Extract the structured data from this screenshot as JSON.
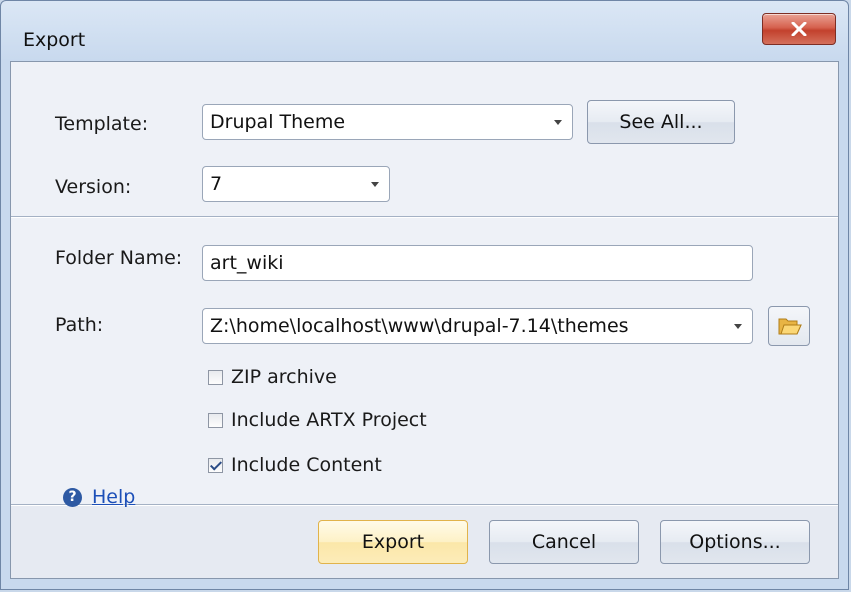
{
  "window": {
    "title": "Export"
  },
  "form": {
    "template_label": "Template:",
    "template_value": "Drupal Theme",
    "see_all_label": "See All...",
    "version_label": "Version:",
    "version_value": "7",
    "folder_name_label": "Folder Name:",
    "folder_name_value": "art_wiki",
    "path_label": "Path:",
    "path_value": "Z:\\home\\localhost\\www\\drupal-7.14\\themes"
  },
  "options": [
    {
      "label": "ZIP archive",
      "checked": false
    },
    {
      "label": "Include ARTX Project",
      "checked": false
    },
    {
      "label": "Include Content",
      "checked": true
    }
  ],
  "footer": {
    "help_label": "Help",
    "export_label": "Export",
    "cancel_label": "Cancel",
    "options_label": "Options..."
  },
  "icons": {
    "close": "close-icon",
    "help": "help-icon",
    "folder": "folder-open-icon"
  }
}
